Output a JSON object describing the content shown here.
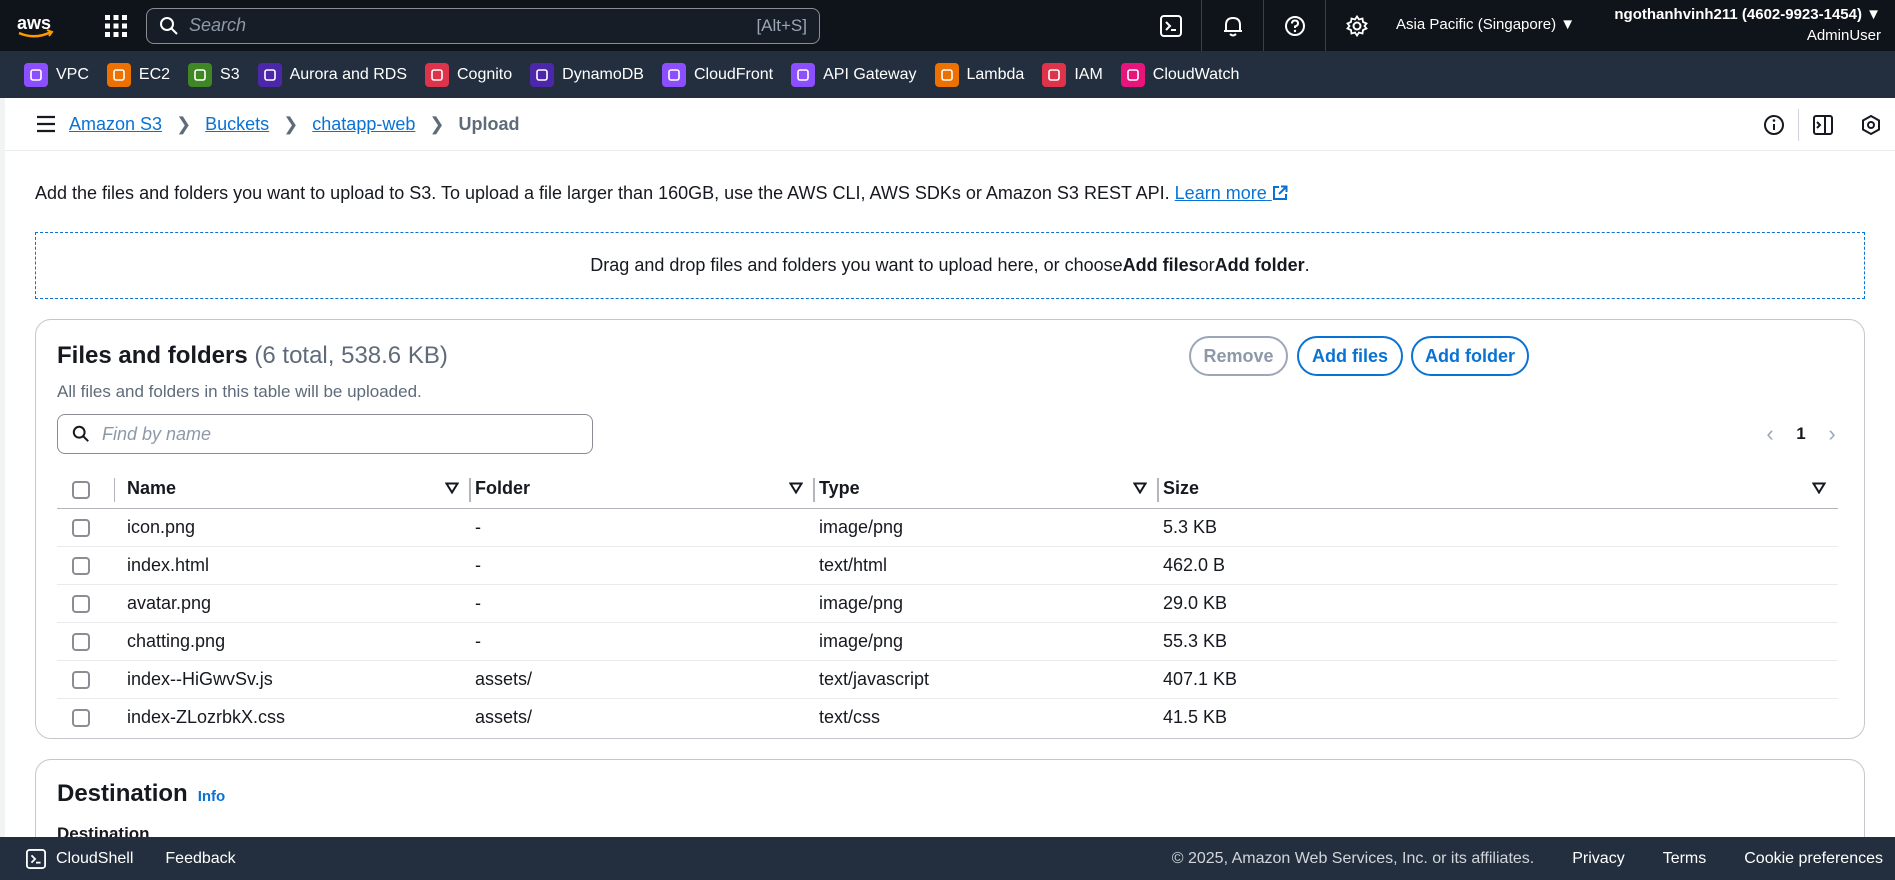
{
  "topbar": {
    "logo_text": "aws",
    "search_placeholder": "Search",
    "search_shortcut": "[Alt+S]",
    "region": "Asia Pacific (Singapore) ▼",
    "account_name": "ngothanhvinh211 (4602-9923-1454) ▼",
    "account_role": "AdminUser"
  },
  "favorites": [
    {
      "label": "VPC",
      "color": "#8c4fff",
      "icon": "vpc-icon"
    },
    {
      "label": "EC2",
      "color": "#ed7100",
      "icon": "ec2-icon"
    },
    {
      "label": "S3",
      "color": "#3f8624",
      "icon": "s3-icon"
    },
    {
      "label": "Aurora and RDS",
      "color": "#4d27aa",
      "icon": "rds-icon"
    },
    {
      "label": "Cognito",
      "color": "#dd344c",
      "icon": "cognito-icon"
    },
    {
      "label": "DynamoDB",
      "color": "#4d27aa",
      "icon": "dynamodb-icon"
    },
    {
      "label": "CloudFront",
      "color": "#8c4fff",
      "icon": "cloudfront-icon"
    },
    {
      "label": "API Gateway",
      "color": "#8c4fff",
      "icon": "apigateway-icon"
    },
    {
      "label": "Lambda",
      "color": "#ed7100",
      "icon": "lambda-icon"
    },
    {
      "label": "IAM",
      "color": "#dd344c",
      "icon": "iam-icon"
    },
    {
      "label": "CloudWatch",
      "color": "#e7157b",
      "icon": "cloudwatch-icon"
    }
  ],
  "breadcrumb": {
    "items": [
      "Amazon S3",
      "Buckets",
      "chatapp-web"
    ],
    "current": "Upload"
  },
  "intro": {
    "text": "Add the files and folders you want to upload to S3. To upload a file larger than 160GB, use the AWS CLI, AWS SDKs or Amazon S3 REST API.",
    "learn_more": "Learn more"
  },
  "dropzone": {
    "prefix": "Drag and drop files and folders you want to upload here, or choose ",
    "add_files": "Add files",
    "or": " or ",
    "add_folder": "Add folder",
    "suffix": "."
  },
  "files_panel": {
    "title": "Files and folders",
    "count": "(6 total, 538.6 KB)",
    "subtitle": "All files and folders in this table will be uploaded.",
    "remove_label": "Remove",
    "add_files_label": "Add files",
    "add_folder_label": "Add folder",
    "find_placeholder": "Find by name",
    "page": "1",
    "columns": [
      "Name",
      "Folder",
      "Type",
      "Size"
    ],
    "rows": [
      {
        "name": "icon.png",
        "folder": "-",
        "type": "image/png",
        "size": "5.3 KB"
      },
      {
        "name": "index.html",
        "folder": "-",
        "type": "text/html",
        "size": "462.0 B"
      },
      {
        "name": "avatar.png",
        "folder": "-",
        "type": "image/png",
        "size": "29.0 KB"
      },
      {
        "name": "chatting.png",
        "folder": "-",
        "type": "image/png",
        "size": "55.3 KB"
      },
      {
        "name": "index--HiGwvSv.js",
        "folder": "assets/",
        "type": "text/javascript",
        "size": "407.1 KB"
      },
      {
        "name": "index-ZLozrbkX.css",
        "folder": "assets/",
        "type": "text/css",
        "size": "41.5 KB"
      }
    ]
  },
  "destination_panel": {
    "title": "Destination",
    "info": "Info",
    "subtitle": "Destination"
  },
  "footer": {
    "cloudshell": "CloudShell",
    "feedback": "Feedback",
    "copyright": "© 2025, Amazon Web Services, Inc. or its affiliates.",
    "privacy": "Privacy",
    "terms": "Terms",
    "cookies": "Cookie preferences"
  }
}
